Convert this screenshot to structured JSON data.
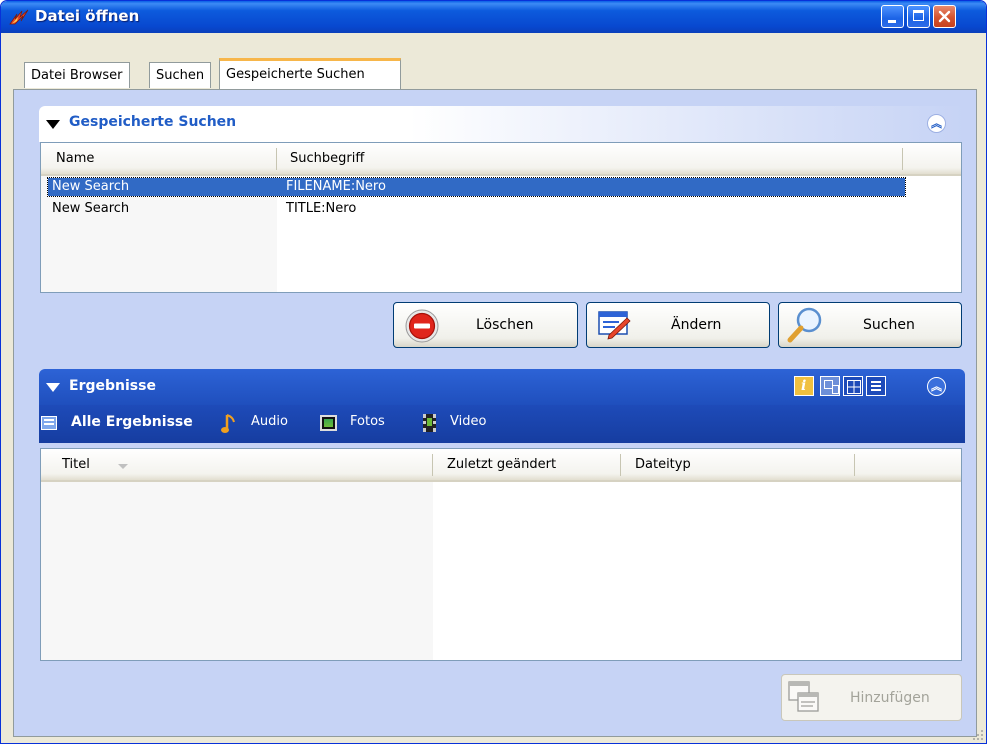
{
  "window": {
    "title": "Datei öffnen"
  },
  "tabs": [
    {
      "label": "Datei Browser",
      "active": false
    },
    {
      "label": "Suchen",
      "active": false
    },
    {
      "label": "Gespeicherte Suchen",
      "active": true
    }
  ],
  "saved_searches": {
    "title": "Gespeicherte Suchen",
    "columns": [
      "Name",
      "Suchbegriff"
    ],
    "rows": [
      {
        "name": "New Search",
        "term": "FILENAME:Nero",
        "selected": true
      },
      {
        "name": "New Search",
        "term": "TITLE:Nero",
        "selected": false
      }
    ],
    "buttons": {
      "delete": "Löschen",
      "edit": "Ändern",
      "search": "Suchen"
    }
  },
  "results": {
    "title": "Ergebnisse",
    "filters": [
      {
        "label": "Alle Ergebnisse",
        "icon": "list-icon",
        "active": true
      },
      {
        "label": "Audio",
        "icon": "music-note-icon",
        "active": false
      },
      {
        "label": "Fotos",
        "icon": "photo-icon",
        "active": false
      },
      {
        "label": "Video",
        "icon": "film-icon",
        "active": false
      }
    ],
    "columns": [
      "Titel",
      "Zuletzt geändert",
      "Dateityp"
    ],
    "add_button": "Hinzufügen"
  },
  "colors": {
    "selection": "#316ac5",
    "panel_header_blue": "#215dc6",
    "results_header": "#2d63d6",
    "tab_highlight": "#f7b64a"
  }
}
